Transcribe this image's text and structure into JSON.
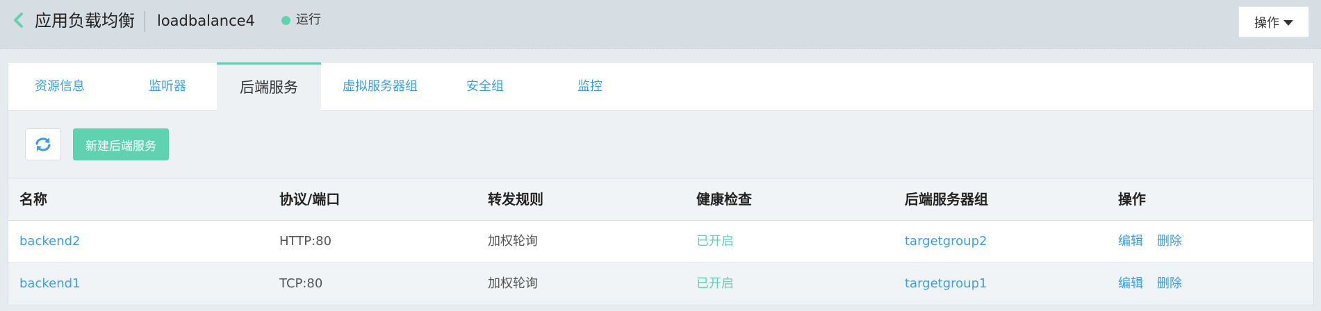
{
  "header": {
    "title": "应用负载均衡",
    "instance_name": "loadbalance4",
    "status": "运行",
    "ops_label": "操作",
    "colors": {
      "status": "#5fd3b0",
      "back": "#5fd3b0"
    }
  },
  "tabs": [
    {
      "label": "资源信息",
      "active": false
    },
    {
      "label": "监听器",
      "active": false
    },
    {
      "label": "后端服务",
      "active": true
    },
    {
      "label": "虚拟服务器组",
      "active": false
    },
    {
      "label": "安全组",
      "active": false
    },
    {
      "label": "监控",
      "active": false
    }
  ],
  "toolbar": {
    "refresh_icon": "refresh-icon",
    "new_label": "新建后端服务"
  },
  "table": {
    "columns": [
      "名称",
      "协议/端口",
      "转发规则",
      "健康检查",
      "后端服务器组",
      "操作"
    ],
    "rows": [
      {
        "name": "backend2",
        "protocol": "HTTP:80",
        "rule": "加权轮询",
        "health": "已开启",
        "group": "targetgroup2",
        "edit": "编辑",
        "delete": "删除"
      },
      {
        "name": "backend1",
        "protocol": "TCP:80",
        "rule": "加权轮询",
        "health": "已开启",
        "group": "targetgroup1",
        "edit": "编辑",
        "delete": "删除"
      }
    ]
  }
}
